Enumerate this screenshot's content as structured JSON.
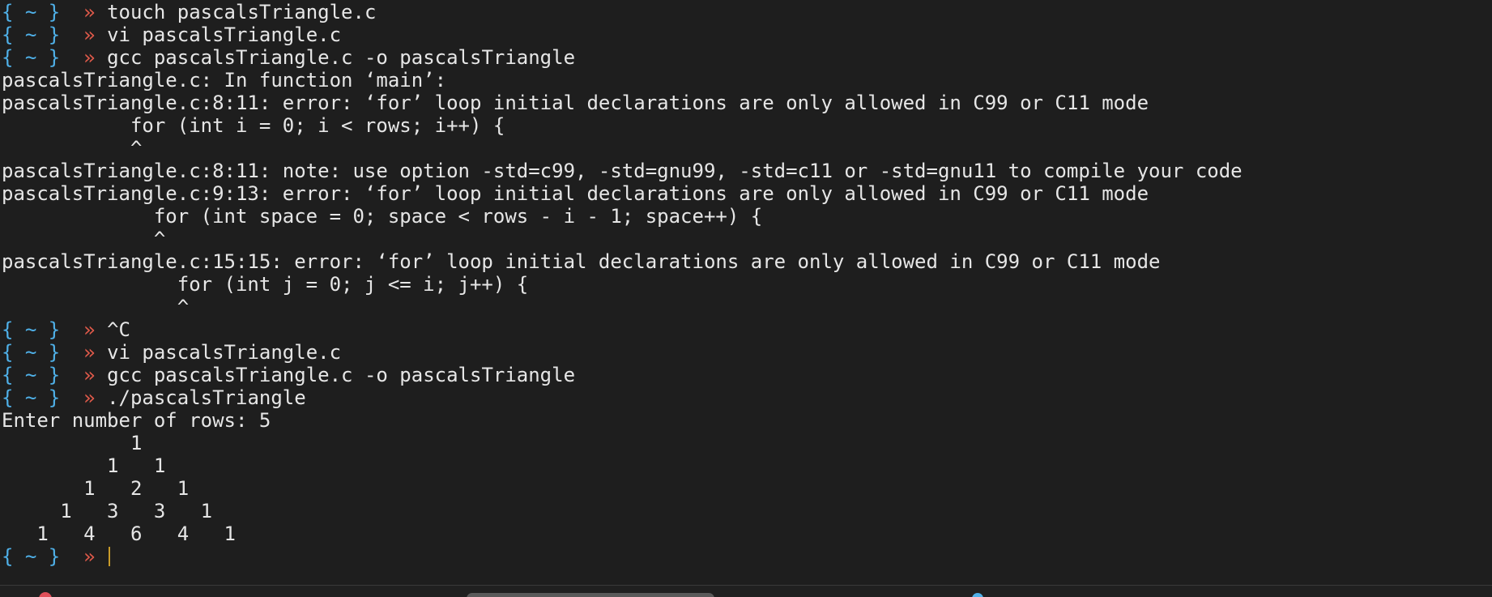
{
  "terminal": {
    "prompt_dir": "{ ~ }",
    "prompt_arrow": "»",
    "colors": {
      "background": "#1e1e1e",
      "text": "#e6e6e6",
      "prompt_dir": "#4fb0e8",
      "prompt_arrow": "#e05a4a",
      "cursor": "#c89b2a"
    },
    "lines": [
      {
        "type": "prompt",
        "cmd": "touch pascalsTriangle.c"
      },
      {
        "type": "prompt",
        "cmd": "vi pascalsTriangle.c"
      },
      {
        "type": "prompt",
        "cmd": "gcc pascalsTriangle.c -o pascalsTriangle"
      },
      {
        "type": "output",
        "text": "pascalsTriangle.c: In function ‘main’:"
      },
      {
        "type": "output",
        "text": "pascalsTriangle.c:8:11: error: ‘for’ loop initial declarations are only allowed in C99 or C11 mode"
      },
      {
        "type": "output",
        "text": "           for (int i = 0; i < rows; i++) {"
      },
      {
        "type": "output",
        "text": "           ^"
      },
      {
        "type": "output",
        "text": "pascalsTriangle.c:8:11: note: use option -std=c99, -std=gnu99, -std=c11 or -std=gnu11 to compile your code"
      },
      {
        "type": "output",
        "text": "pascalsTriangle.c:9:13: error: ‘for’ loop initial declarations are only allowed in C99 or C11 mode"
      },
      {
        "type": "output",
        "text": "             for (int space = 0; space < rows - i - 1; space++) {"
      },
      {
        "type": "output",
        "text": "             ^"
      },
      {
        "type": "output",
        "text": "pascalsTriangle.c:15:15: error: ‘for’ loop initial declarations are only allowed in C99 or C11 mode"
      },
      {
        "type": "output",
        "text": "               for (int j = 0; j <= i; j++) {"
      },
      {
        "type": "output",
        "text": "               ^"
      },
      {
        "type": "prompt",
        "cmd": "^C"
      },
      {
        "type": "prompt",
        "cmd": "vi pascalsTriangle.c"
      },
      {
        "type": "prompt",
        "cmd": "gcc pascalsTriangle.c -o pascalsTriangle"
      },
      {
        "type": "prompt",
        "cmd": "./pascalsTriangle"
      },
      {
        "type": "output",
        "text": "Enter number of rows: 5"
      },
      {
        "type": "output",
        "text": "           1"
      },
      {
        "type": "output",
        "text": "         1   1"
      },
      {
        "type": "output",
        "text": "       1   2   1"
      },
      {
        "type": "output",
        "text": "     1   3   3   1"
      },
      {
        "type": "output",
        "text": "   1   4   6   4   1"
      },
      {
        "type": "prompt",
        "cmd": "",
        "cursor": true
      }
    ]
  },
  "taskbar": {
    "colors": {
      "background": "#202020",
      "red_icon": "#e0505a",
      "pill": "#5a5a5a",
      "blue_icon": "#4fb0e8"
    }
  }
}
